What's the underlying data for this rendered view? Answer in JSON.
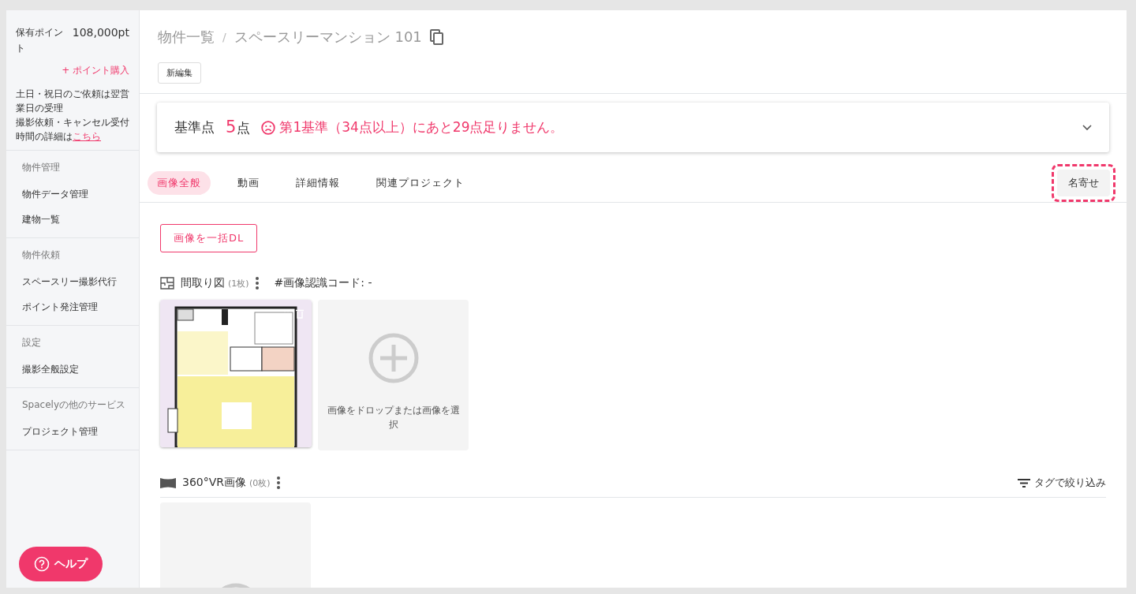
{
  "sidebar": {
    "points": {
      "label": "保有ポイント",
      "value": "108,000pt",
      "buy_link": "+ ポイント購入"
    },
    "notes": [
      {
        "text": "土日・祝日のご依頼は翌営業日の受理"
      },
      {
        "text": "撮影依頼・キャンセル受付時間の詳細は",
        "link": "こちら"
      }
    ],
    "sections": [
      {
        "heading": "物件管理",
        "items": [
          "物件データ管理",
          "建物一覧"
        ]
      },
      {
        "heading": "物件依頼",
        "items": [
          "スペースリー撮影代行",
          "ポイント発注管理"
        ]
      },
      {
        "heading": "設定",
        "items": [
          "撮影全般設定"
        ]
      },
      {
        "heading": "Spacelyの他のサービス",
        "items": [
          "プロジェクト管理"
        ]
      }
    ],
    "help_button": "ヘルプ"
  },
  "breadcrumb": [
    "物件一覧",
    "スペースリーマンション 101"
  ],
  "breadcrumb_separator": "/",
  "edit_button": "新編集",
  "score_card": {
    "label": "基準点",
    "score": "5",
    "unit": "点",
    "message": "第1基準（34点以上）にあと29点足りません。",
    "expanded": false
  },
  "tabs": [
    {
      "label": "画像全般",
      "selected": true
    },
    {
      "label": "動画",
      "selected": false
    },
    {
      "label": "詳細情報",
      "selected": false
    },
    {
      "label": "関連プロジェクト",
      "selected": false
    }
  ],
  "merge_button": {
    "label": "名寄せ",
    "highlighted": true
  },
  "download_button": "画像を一括DL",
  "sections": [
    {
      "kind": "floorplan",
      "title": "間取り図",
      "count": "(1枚)",
      "code": "#画像認識コード: -",
      "tiles": [
        {
          "kind": "picture"
        },
        {
          "kind": "upload",
          "text": "画像をドロップまたは画像を選択"
        }
      ]
    },
    {
      "kind": "vr",
      "title": "360°VR画像",
      "count": "(0枚)",
      "filter": "タグで絞り込み",
      "tiles": [
        {
          "kind": "upload"
        }
      ]
    }
  ]
}
